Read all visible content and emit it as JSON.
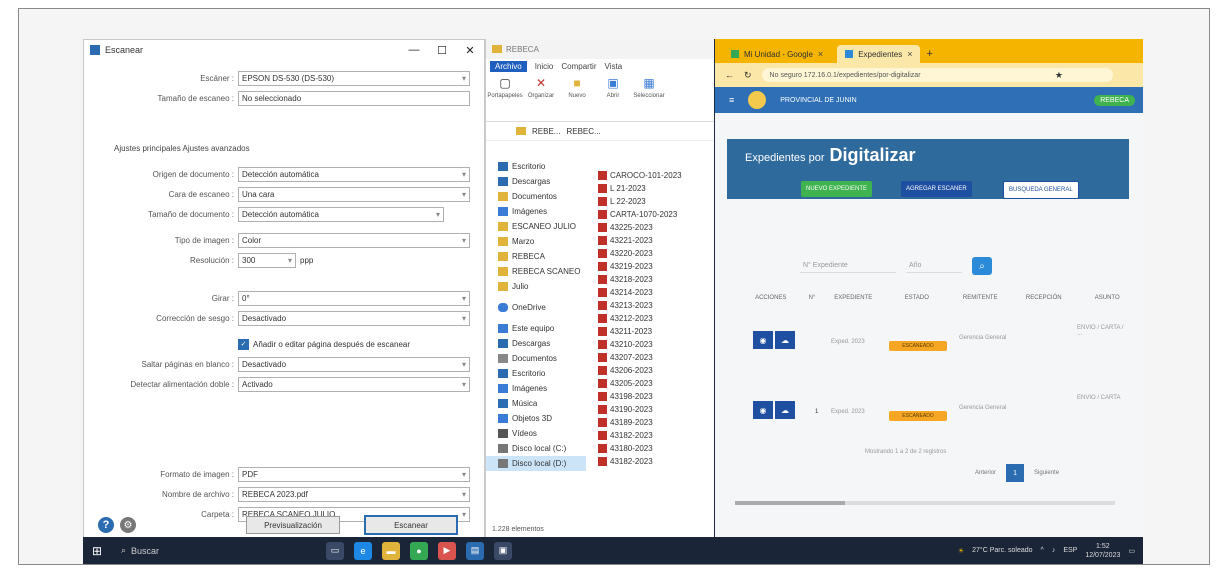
{
  "scanner": {
    "title": "Escanear",
    "minimize": "—",
    "maximize": "☐",
    "close": "✕",
    "fields": [
      {
        "label": "Escáner :",
        "value": "EPSON DS-530 (DS-530)",
        "chevron": "▾"
      },
      {
        "label": "Tamaño de escaneo :",
        "value": "No seleccionado",
        "chevron": ""
      }
    ],
    "section": "Ajustes principales  Ajustes avanzados",
    "settings": [
      {
        "label": "Origen de documento :",
        "value": "Detección automática",
        "chevron": "▾"
      },
      {
        "label": "Cara de escaneo :",
        "value": "Una cara",
        "chevron": "▾"
      },
      {
        "label": "Tamaño de documento :",
        "value": "Detección automática",
        "chevron": "▾"
      },
      {
        "label": "Tipo de imagen :",
        "value": "Color",
        "chevron": "▾"
      },
      {
        "label": "Resolución :",
        "value": "300",
        "chevron": "▾"
      },
      {
        "label": "Girar :",
        "value": "0°",
        "chevron": "▾"
      },
      {
        "label": "Corrección de sesgo :",
        "value": "Desactivado",
        "chevron": "▾"
      },
      {
        "label": "Saltar páginas en blanco :",
        "value": "Desactivado",
        "chevron": "▾"
      },
      {
        "label": "Detectar alimentación doble :",
        "value": "Activado",
        "chevron": "▾"
      }
    ],
    "resolution_unit": "ppp",
    "checkbox_label": "Añadir o editar página después de escanear",
    "output": [
      {
        "label": "Formato de imagen :",
        "value": "PDF",
        "chevron": "▾"
      },
      {
        "label": "Nombre de archivo :",
        "value": "REBECA 2023.pdf",
        "chevron": "▾"
      },
      {
        "label": "Carpeta :",
        "value": "REBECA SCANEO JULIO",
        "chevron": "▾"
      }
    ],
    "preview_button": "Previsualización",
    "scan_button": "Escanear"
  },
  "explorer": {
    "title": "REBECA",
    "tabs": [
      "Archivo",
      "Inicio",
      "Compartir",
      "Vista"
    ],
    "ribbon": [
      "Portapapeles",
      "Organizar",
      "Nuevo",
      "Abrir",
      "Seleccionar"
    ],
    "path": [
      "REBE...",
      "REBEC..."
    ],
    "nav": [
      {
        "label": "Escritorio",
        "color": "#2b6cb0"
      },
      {
        "label": "Descargas",
        "color": "#2b6cb0"
      },
      {
        "label": "Documentos",
        "color": "#e0b33a"
      },
      {
        "label": "Imágenes",
        "color": "#3a7bd5"
      },
      {
        "label": "ESCANEO JULIO",
        "color": "#e0b33a"
      },
      {
        "label": "Marzo",
        "color": "#e0b33a"
      },
      {
        "label": "REBECA",
        "color": "#e0b33a"
      },
      {
        "label": "REBECA SCANEO",
        "color": "#e0b33a"
      },
      {
        "label": "Julio",
        "color": "#e0b33a"
      },
      {
        "label": "OneDrive",
        "color": "#3a7bd5"
      },
      {
        "label": "Este equipo",
        "color": "#3a7bd5"
      },
      {
        "label": "Descargas",
        "color": "#2b6cb0"
      },
      {
        "label": "Documentos",
        "color": "#888"
      },
      {
        "label": "Escritorio",
        "color": "#2b6cb0"
      },
      {
        "label": "Imágenes",
        "color": "#3a7bd5"
      },
      {
        "label": "Música",
        "color": "#2b6cb0"
      },
      {
        "label": "Objetos 3D",
        "color": "#3a7bd5"
      },
      {
        "label": "Vídeos",
        "color": "#555"
      },
      {
        "label": "Disco local (C:)",
        "color": "#777"
      },
      {
        "label": "Disco local (D:)",
        "color": "#777"
      }
    ],
    "files": [
      "CAROCO-101-2023",
      "L 21-2023",
      "L 22-2023",
      "CARTA-1070-2023",
      "43225-2023",
      "43221-2023",
      "43220-2023",
      "43219-2023",
      "43218-2023",
      "43214-2023",
      "43213-2023",
      "43212-2023",
      "43211-2023",
      "43210-2023",
      "43207-2023",
      "43206-2023",
      "43205-2023",
      "43198-2023",
      "43190-2023",
      "43189-2023",
      "43182-2023",
      "43180-2023",
      "43182-2023"
    ],
    "status": "1.228 elementos"
  },
  "browser": {
    "tabs": [
      {
        "label": "Mi Unidad - Google",
        "active": false
      },
      {
        "label": "Expedientes",
        "active": true
      }
    ],
    "new_tab": "+",
    "url": "No seguro  172.16.0.1/expedientes/por-digitalizar",
    "app_title": "PROVINCIAL DE JUNIN",
    "user": "REBECA",
    "banner_prefix": "Expedientes por",
    "banner_title": "Digitalizar",
    "banner_buttons": [
      "NUEVO EXPEDIENTE",
      "AGREGAR ESCANER",
      "BUSQUEDA GENERAL"
    ],
    "search_placeholder": "N° Expediente",
    "search_type": "Año",
    "columns": [
      "ACCIONES",
      "N°",
      "EXPEDIENTE",
      "ESTADO",
      "REMITENTE",
      "RECEPCIÓN",
      "ASUNTO"
    ],
    "rows": [
      {
        "number": "",
        "expediente": "Exped. 2023",
        "status": "ESCANEADO",
        "sender": "Gerencia General",
        "subject": "ENVIO / CARTA / ..."
      },
      {
        "number": "1",
        "expediente": "Exped. 2023",
        "status": "ESCANEADO",
        "sender": "Gerencia General",
        "subject": "ENVIO / CARTA"
      }
    ],
    "showing": "Mostrando 1 a 2 de 2 registros",
    "prev": "Anterior",
    "page": "1",
    "next": "Siguiente"
  },
  "taskbar": {
    "search": "Buscar",
    "weather": "27°C  Parc. soleado",
    "time": "1:52",
    "date": "12/07/2023",
    "lang": "ESP",
    "apps": [
      {
        "name": "task-view",
        "color": "#3a4a66",
        "glyph": "▭"
      },
      {
        "name": "edge",
        "color": "#1e88e5",
        "glyph": "e"
      },
      {
        "name": "file-explorer",
        "color": "#e0b33a",
        "glyph": "▬"
      },
      {
        "name": "chrome",
        "color": "#34a853",
        "glyph": "●"
      },
      {
        "name": "media",
        "color": "#d9534f",
        "glyph": "▶"
      },
      {
        "name": "scanner",
        "color": "#2b6cb0",
        "glyph": "▤"
      },
      {
        "name": "terminal",
        "color": "#3a4a66",
        "glyph": "▣"
      }
    ]
  }
}
